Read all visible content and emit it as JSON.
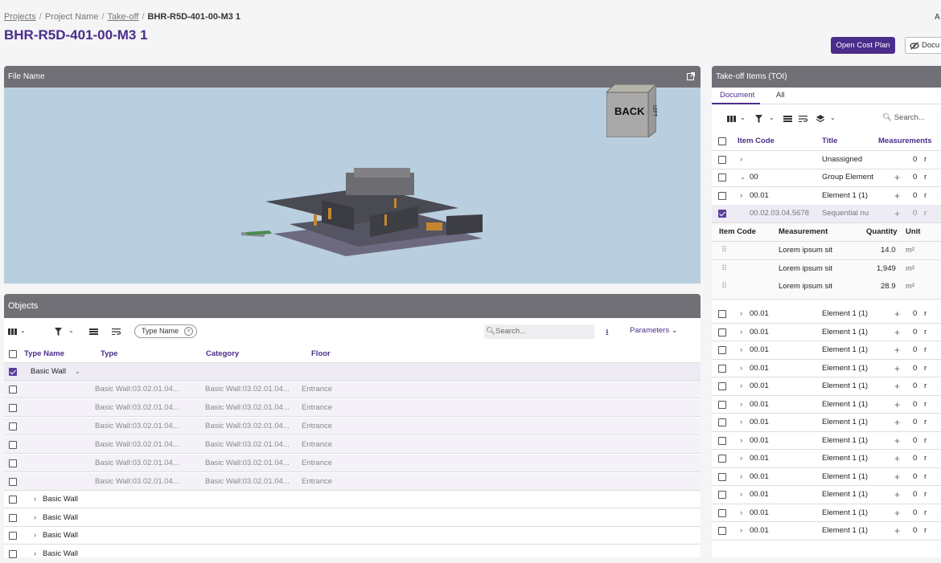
{
  "breadcrumb": {
    "projects": "Projects",
    "project_name": "Project Name",
    "takeoff": "Take-off",
    "current": "BHR-R5D-401-00-M3 1"
  },
  "page_title": "BHR-R5D-401-00-M3 1",
  "account_initial": "A",
  "actions": {
    "open_cost_plan": "Open Cost Plan",
    "documents": "Docu"
  },
  "viewer": {
    "header": "File Name",
    "navcube_face": "BACK",
    "navcube_side": "LEFT"
  },
  "objects": {
    "header": "Objects",
    "filter_chip": "Type Name",
    "search_placeholder": "Search...",
    "parameters_label": "Parameters",
    "columns": [
      "Type Name",
      "Type",
      "Category",
      "Floor"
    ],
    "group_label": "Basic Wall",
    "child_rows": [
      {
        "type": "Basic Wall:03.02.01.04...",
        "category": "Basic Wall:03.02.01.04...",
        "floor": "Entrance"
      },
      {
        "type": "Basic Wall:03.02.01.04...",
        "category": "Basic Wall:03.02.01.04...",
        "floor": "Entrance"
      },
      {
        "type": "Basic Wall:03.02.01.04...",
        "category": "Basic Wall:03.02.01.04...",
        "floor": "Entrance"
      },
      {
        "type": "Basic Wall:03.02.01.04...",
        "category": "Basic Wall:03.02.01.04...",
        "floor": "Entrance"
      },
      {
        "type": "Basic Wall:03.02.01.04...",
        "category": "Basic Wall:03.02.01.04...",
        "floor": "Entrance"
      },
      {
        "type": "Basic Wall:03.02.01.04...",
        "category": "Basic Wall:03.02.01.04...",
        "floor": "Entrance"
      }
    ],
    "collapsed_rows": [
      "Basic Wall",
      "Basic Wall",
      "Basic Wall",
      "Basic Wall"
    ]
  },
  "toi": {
    "header": "Take-off Items (TOI)",
    "tabs": [
      "Document",
      "All"
    ],
    "search_placeholder": "Search...",
    "columns": [
      "Item Code",
      "Title",
      "Measurements"
    ],
    "rows": [
      {
        "code": "",
        "title": "Unassigned",
        "plus": "",
        "count": "0"
      },
      {
        "code": "00",
        "title": "Group Element",
        "plus": "+",
        "count": "0"
      },
      {
        "code": "00.01",
        "title": "Element 1 (1)",
        "plus": "+",
        "count": "0"
      },
      {
        "code": "00.02.03.04.5678",
        "title": "Sequential nu",
        "plus": "+",
        "count": "0"
      }
    ],
    "sub_columns": [
      "Item Code",
      "Measurement",
      "Quantity",
      "Unit"
    ],
    "measurements": [
      {
        "name": "Lorem ipsum sit",
        "qty": "14.0",
        "unit": "m²"
      },
      {
        "name": "Lorem ipsum sit",
        "qty": "1,949",
        "unit": "m²"
      },
      {
        "name": "Lorem ipsum sit",
        "qty": "28.9",
        "unit": "m²"
      }
    ],
    "element_rows": [
      {
        "code": "00.01",
        "title": "Element 1 (1)",
        "plus": "+",
        "count": "0"
      },
      {
        "code": "00.01",
        "title": "Element 1 (1)",
        "plus": "+",
        "count": "0"
      },
      {
        "code": "00.01",
        "title": "Element 1 (1)",
        "plus": "+",
        "count": "0"
      },
      {
        "code": "00.01",
        "title": "Element 1 (1)",
        "plus": "+",
        "count": "0"
      },
      {
        "code": "00.01",
        "title": "Element 1 (1)",
        "plus": "+",
        "count": "0"
      },
      {
        "code": "00.01",
        "title": "Element 1 (1)",
        "plus": "+",
        "count": "0"
      },
      {
        "code": "00.01",
        "title": "Element 1 (1)",
        "plus": "+",
        "count": "0"
      },
      {
        "code": "00.01",
        "title": "Element 1 (1)",
        "plus": "+",
        "count": "0"
      },
      {
        "code": "00.01",
        "title": "Element 1 (1)",
        "plus": "+",
        "count": "0"
      },
      {
        "code": "00.01",
        "title": "Element 1 (1)",
        "plus": "+",
        "count": "0"
      },
      {
        "code": "00.01",
        "title": "Element 1 (1)",
        "plus": "+",
        "count": "0"
      },
      {
        "code": "00.01",
        "title": "Element 1 (1)",
        "plus": "+",
        "count": "0"
      },
      {
        "code": "00.01",
        "title": "Element 1 (1)",
        "plus": "+",
        "count": "0"
      }
    ]
  },
  "colors": {
    "brand": "#4a2d8a",
    "panel_header": "#727077",
    "viewer_bg": "#b9cfdf"
  }
}
